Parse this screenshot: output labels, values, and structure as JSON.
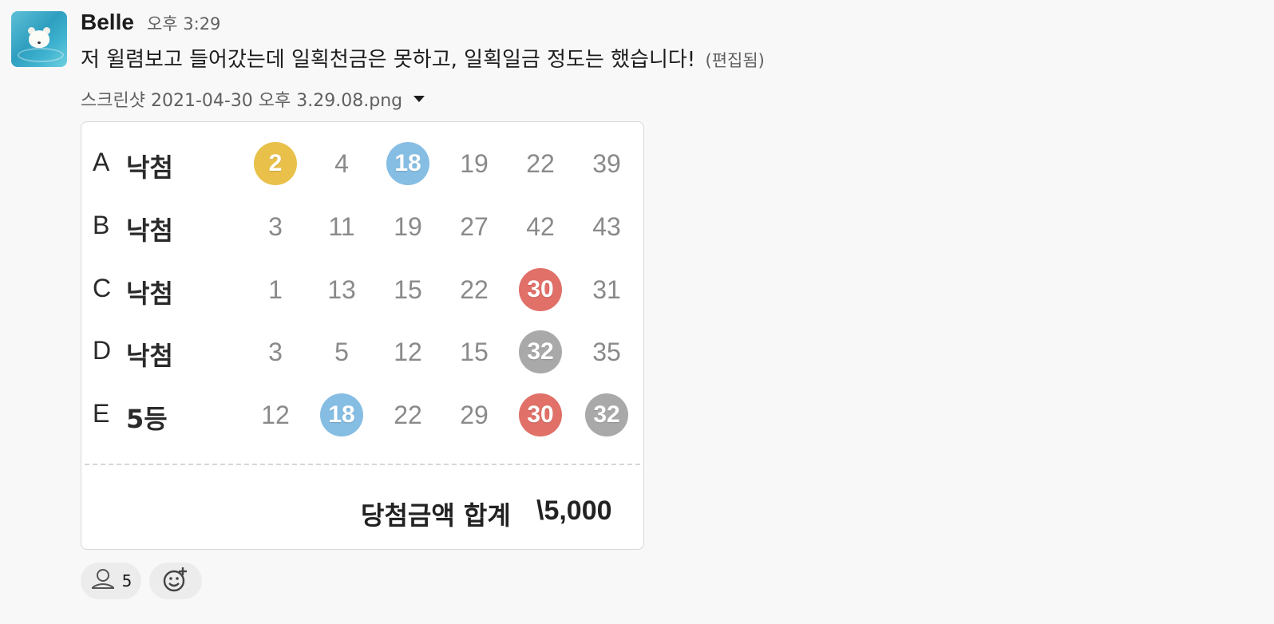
{
  "message": {
    "username": "Belle",
    "timestamp": "오후 3:29",
    "text": "저 윌렴보고 들어갔는데 일획천금은 못하고, 일획일금 정도는 했습니다!",
    "edited_label": "(편집됨)"
  },
  "attachment": {
    "filename": "스크린샷 2021-04-30 오후 3.29.08.png",
    "lottery": {
      "rows": [
        {
          "letter": "A",
          "result": "낙첨",
          "numbers": [
            {
              "value": "2",
              "ball": "yellow"
            },
            {
              "value": "4",
              "ball": ""
            },
            {
              "value": "18",
              "ball": "blue"
            },
            {
              "value": "19",
              "ball": ""
            },
            {
              "value": "22",
              "ball": ""
            },
            {
              "value": "39",
              "ball": ""
            }
          ]
        },
        {
          "letter": "B",
          "result": "낙첨",
          "numbers": [
            {
              "value": "3",
              "ball": ""
            },
            {
              "value": "11",
              "ball": ""
            },
            {
              "value": "19",
              "ball": ""
            },
            {
              "value": "27",
              "ball": ""
            },
            {
              "value": "42",
              "ball": ""
            },
            {
              "value": "43",
              "ball": ""
            }
          ]
        },
        {
          "letter": "C",
          "result": "낙첨",
          "numbers": [
            {
              "value": "1",
              "ball": ""
            },
            {
              "value": "13",
              "ball": ""
            },
            {
              "value": "15",
              "ball": ""
            },
            {
              "value": "22",
              "ball": ""
            },
            {
              "value": "30",
              "ball": "red"
            },
            {
              "value": "31",
              "ball": ""
            }
          ]
        },
        {
          "letter": "D",
          "result": "낙첨",
          "numbers": [
            {
              "value": "3",
              "ball": ""
            },
            {
              "value": "5",
              "ball": ""
            },
            {
              "value": "12",
              "ball": ""
            },
            {
              "value": "15",
              "ball": ""
            },
            {
              "value": "32",
              "ball": "gray"
            },
            {
              "value": "35",
              "ball": ""
            }
          ]
        },
        {
          "letter": "E",
          "result": "5등",
          "numbers": [
            {
              "value": "12",
              "ball": ""
            },
            {
              "value": "18",
              "ball": "blue"
            },
            {
              "value": "22",
              "ball": ""
            },
            {
              "value": "29",
              "ball": ""
            },
            {
              "value": "30",
              "ball": "red"
            },
            {
              "value": "32",
              "ball": "gray"
            }
          ]
        }
      ],
      "total_label": "당첨금액 합계",
      "total_value": "\\5,000"
    }
  },
  "ball_colors": {
    "yellow": "#e8c04a",
    "blue": "#86bde3",
    "red": "#e07068",
    "gray": "#a9a9a9"
  },
  "reactions": {
    "first": {
      "icon": "person-icon",
      "count": "5"
    },
    "add": {
      "icon": "add-reaction-icon"
    }
  }
}
